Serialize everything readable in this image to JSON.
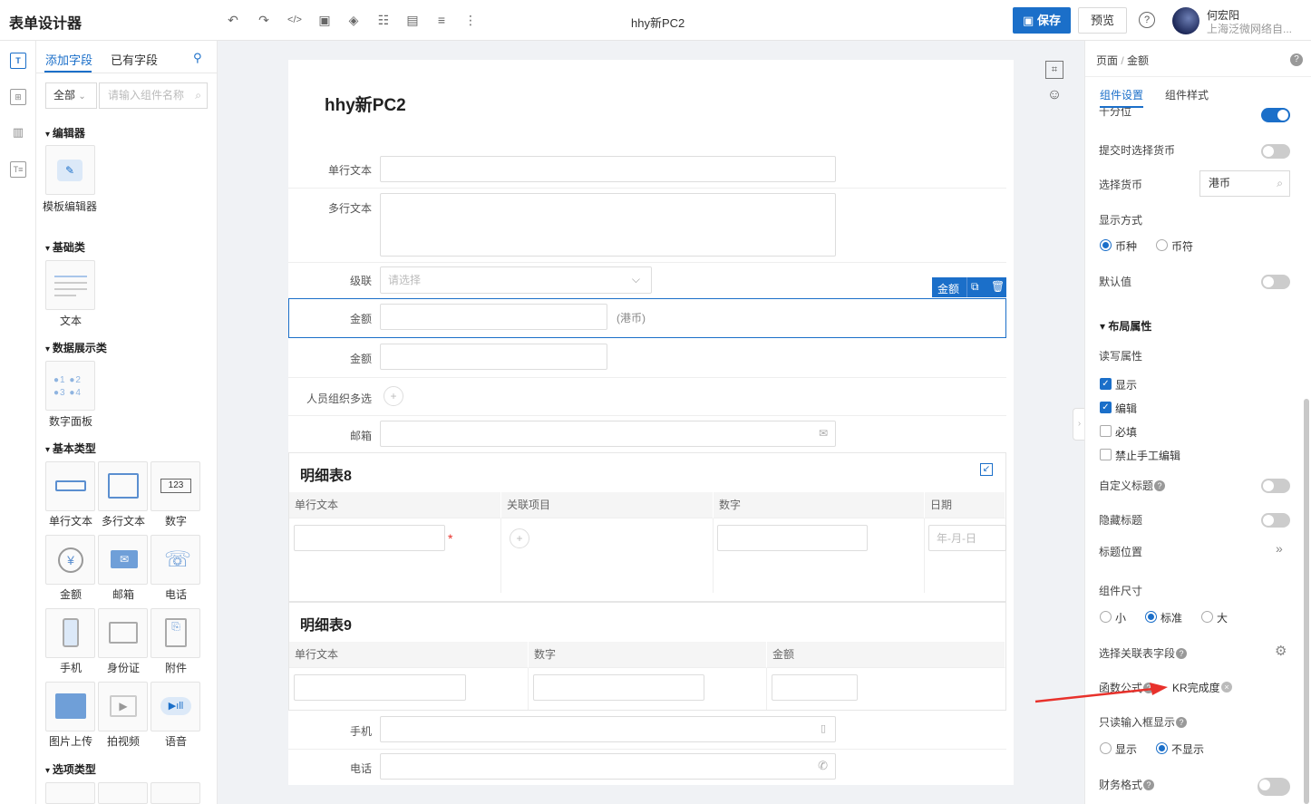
{
  "header": {
    "app_title": "表单设计器",
    "doc_title": "hhy新PC2",
    "save": "保存",
    "preview": "预览",
    "help": "?",
    "user_name": "何宏阳",
    "user_org": "上海泛微网络自..."
  },
  "left": {
    "tab_add": "添加字段",
    "tab_existing": "已有字段",
    "filter": "全部",
    "search_placeholder": "请输入组件名称",
    "cat_editor": "编辑器",
    "comp_template": "模板编辑器",
    "cat_basic": "基础类",
    "comp_text": "文本",
    "cat_data": "数据展示类",
    "comp_numpanel": "数字面板",
    "cat_type": "基本类型",
    "comp_single": "单行文本",
    "comp_multi": "多行文本",
    "comp_number": "数字",
    "comp_amount": "金额",
    "comp_email": "邮箱",
    "comp_phone": "电话",
    "comp_mobile": "手机",
    "comp_idcard": "身份证",
    "comp_attach": "附件",
    "comp_image": "图片上传",
    "comp_video": "拍视频",
    "comp_voice": "语音",
    "cat_option": "选项类型"
  },
  "canvas": {
    "title": "hhy新PC2",
    "f_single": "单行文本",
    "f_multi": "多行文本",
    "f_cascade": "级联",
    "cascade_ph": "请选择",
    "f_amount": "金额",
    "amount_unit": "(港币)",
    "f_amount2": "金额",
    "f_people": "人员组织多选",
    "f_email": "邮箱",
    "toolbar_label": "金额",
    "detail8": {
      "title": "明细表8",
      "cols": [
        "单行文本",
        "关联项目",
        "数字",
        "日期"
      ],
      "date_ph": "年-月-日"
    },
    "detail9": {
      "title": "明细表9",
      "cols": [
        "单行文本",
        "数字",
        "金额"
      ]
    },
    "f_mobile": "手机",
    "f_phone": "电话"
  },
  "right": {
    "crumb_page": "页面",
    "crumb_sep": "/",
    "crumb_field": "金额",
    "tab_settings": "组件设置",
    "tab_style": "组件样式",
    "thousands": "千分位",
    "currency_on_submit": "提交时选择货币",
    "select_currency": "选择货币",
    "currency_value": "港币",
    "display_mode": "显示方式",
    "opt_currency_type": "币种",
    "opt_currency_symbol": "币符",
    "default_value": "默认值",
    "layout_section": "布局属性",
    "rw_attr": "读写属性",
    "chk_show": "显示",
    "chk_edit": "编辑",
    "chk_required": "必填",
    "chk_no_manual": "禁止手工编辑",
    "custom_title": "自定义标题",
    "hide_title": "隐藏标题",
    "title_position": "标题位置",
    "comp_size": "组件尺寸",
    "size_small": "小",
    "size_standard": "标准",
    "size_large": "大",
    "link_field": "选择关联表字段",
    "formula": "函数公式",
    "formula_value": "KR完成度",
    "readonly_display": "只读输入框显示",
    "ro_show": "显示",
    "ro_hide": "不显示",
    "finance_format": "财务格式"
  },
  "colors": {
    "accent": "#1b6fc9",
    "arrow": "#e8312b"
  }
}
